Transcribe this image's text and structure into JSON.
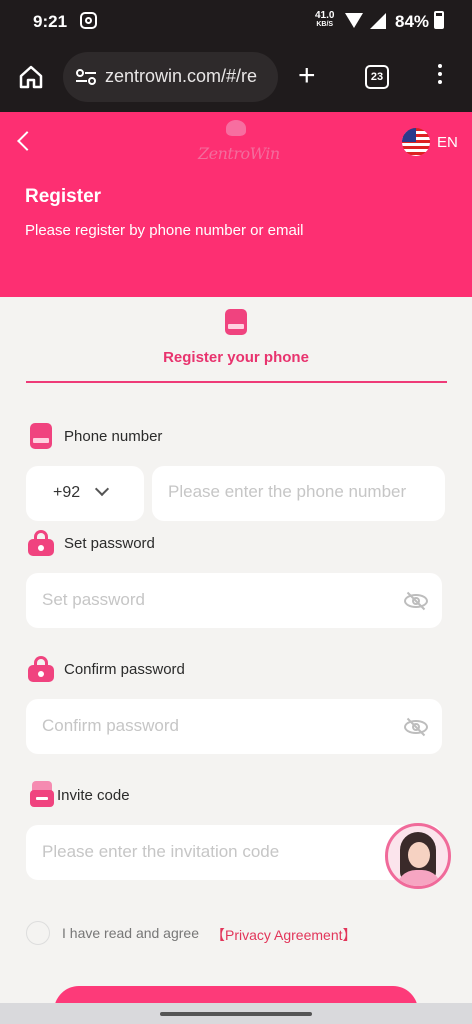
{
  "status_bar": {
    "time": "9:21",
    "net_speed_value": "41.0",
    "net_speed_unit": "KB/S",
    "battery": "84%"
  },
  "browser": {
    "url": "zentrowin.com/#/re",
    "tab_count": "23"
  },
  "header": {
    "logo_text": "ZentroWin",
    "language": "EN",
    "title": "Register",
    "subtitle": "Please register by phone number or email"
  },
  "tab": {
    "label": "Register your phone"
  },
  "form": {
    "phone": {
      "label": "Phone number",
      "country_code": "+92",
      "placeholder": "Please enter the phone number"
    },
    "password": {
      "label": "Set password",
      "placeholder": "Set password"
    },
    "confirm": {
      "label": "Confirm password",
      "placeholder": "Confirm password"
    },
    "invite": {
      "label": "Invite code",
      "placeholder": "Please enter the invitation code"
    },
    "agreement": {
      "text": "I have read and agree",
      "link": "【Privacy Agreement】",
      "checked": false
    }
  },
  "colors": {
    "brand_pink": "#fd2f72",
    "accent_text": "#e8336e",
    "link_red": "#e2355a"
  },
  "icons": [
    "instagram-icon",
    "wifi-icon",
    "signal-icon",
    "battery-icon",
    "home-icon",
    "site-settings-icon",
    "plus-icon",
    "more-menu-icon",
    "back-icon",
    "us-flag-icon",
    "phone-icon",
    "lock-icon",
    "invite-icon",
    "eye-off-icon",
    "chevron-down-icon"
  ]
}
